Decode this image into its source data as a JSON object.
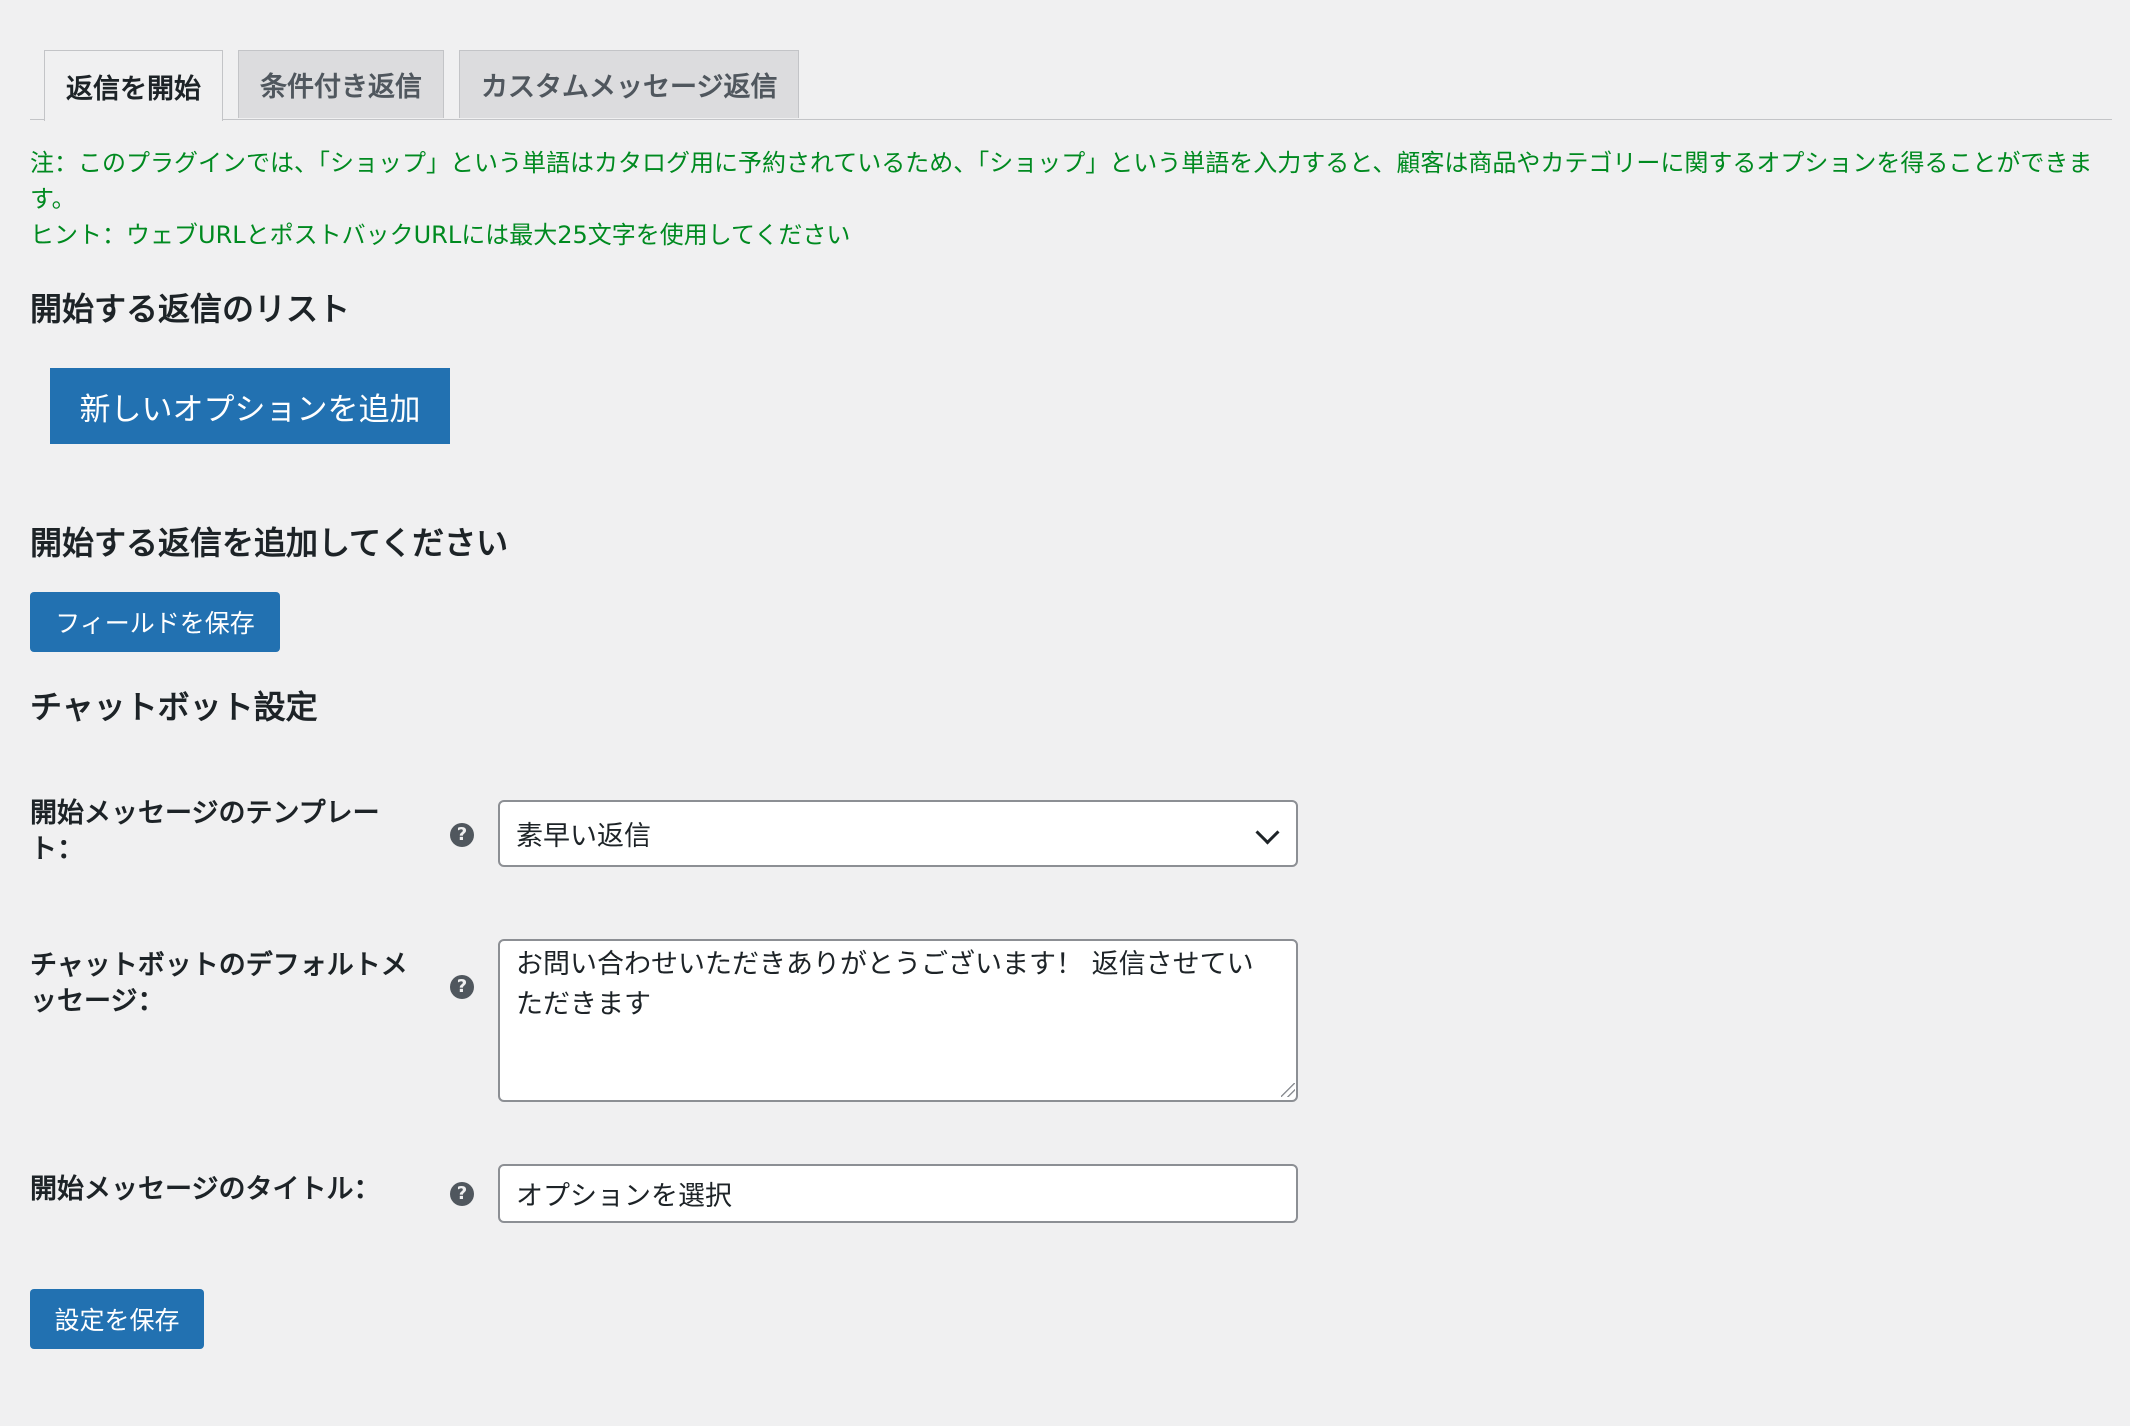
{
  "tabs": [
    {
      "label": "返信を開始",
      "active": true
    },
    {
      "label": "条件付き返信",
      "active": false
    },
    {
      "label": "カスタムメッセージ返信",
      "active": false
    }
  ],
  "notes": {
    "note": "注：このプラグインでは、「ショップ」という単語はカタログ用に予約されているため、「ショップ」という単語を入力すると、顧客は商品やカテゴリーに関するオプションを得ることができます。",
    "hint": "ヒント：ウェブURLとポストバックURLには最大25文字を使用してください"
  },
  "list_section": {
    "heading": "開始する返信のリスト",
    "add_button": "新しいオプションを追加"
  },
  "add_section": {
    "heading": "開始する返信を追加してください",
    "save_fields_button": "フィールドを保存"
  },
  "settings": {
    "heading": "チャットボット設定",
    "template_label": "開始メッセージのテンプレート：",
    "template_value": "素早い返信",
    "default_message_label": "チャットボットのデフォルトメッセージ：",
    "default_message_value": "お問い合わせいただきありがとうございます！ 返信させていただきます",
    "title_label": "開始メッセージのタイトル：",
    "title_value": "オプションを選択",
    "help_glyph": "?",
    "save_button": "設定を保存"
  },
  "colors": {
    "primary": "#2271b1",
    "note_green": "#008a20",
    "background": "#f0f0f1"
  }
}
